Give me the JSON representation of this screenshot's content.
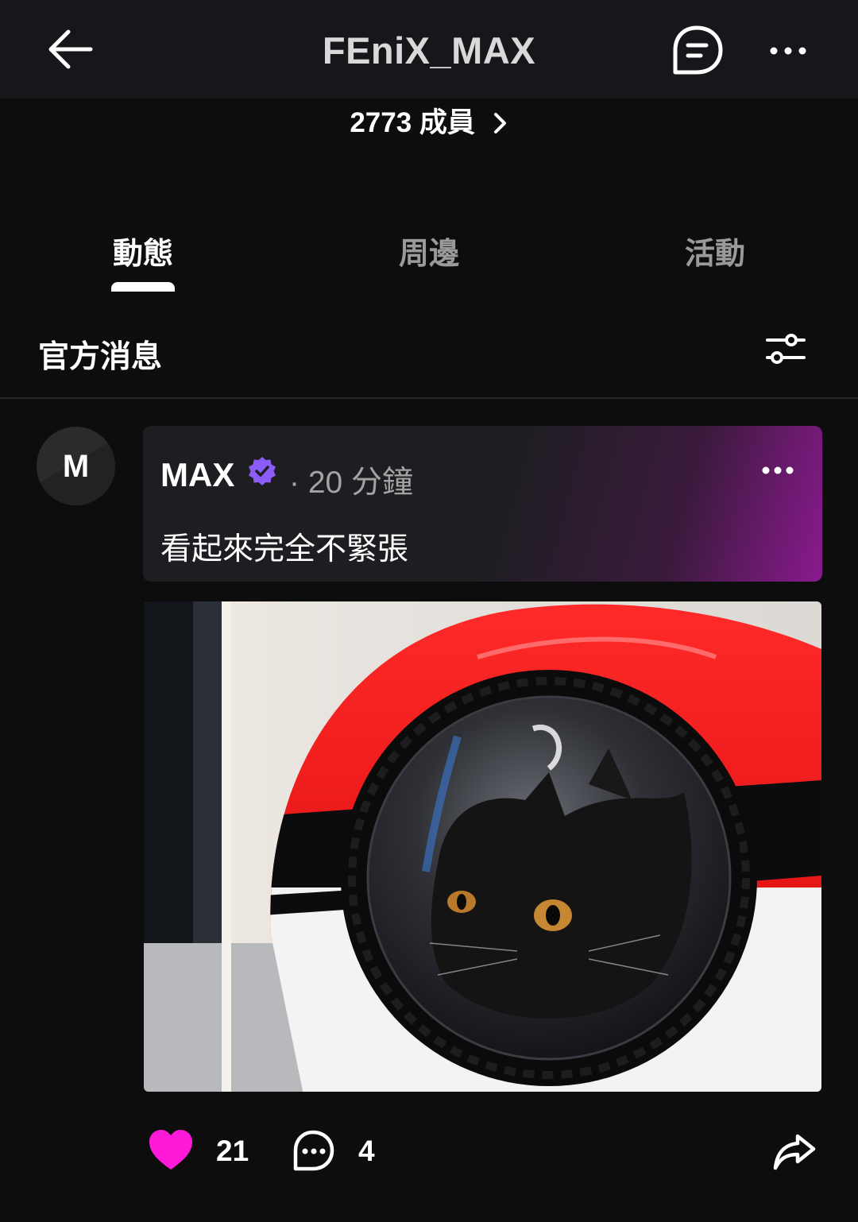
{
  "header": {
    "title": "FEniX_MAX",
    "members_label": "2773 成員",
    "icons": {
      "back": "arrow-left-icon",
      "chat": "chat-bubble-icon",
      "more": "more-horizontal-icon"
    }
  },
  "tabs": [
    {
      "label": "動態",
      "active": true
    },
    {
      "label": "周邊",
      "active": false
    },
    {
      "label": "活動",
      "active": false
    }
  ],
  "section": {
    "title": "官方消息",
    "filter_icon": "sliders-icon"
  },
  "post": {
    "avatar_letter": "M",
    "author": "MAX",
    "verified": true,
    "time": "· 20 分鐘",
    "text": "看起來完全不緊張",
    "image_description_icon": "photo",
    "likes": "21",
    "comments": "4",
    "colors": {
      "verified": "#8b5cf6",
      "like": "#ff1ad9",
      "card_gradient_end": "#8a1a8e"
    }
  }
}
